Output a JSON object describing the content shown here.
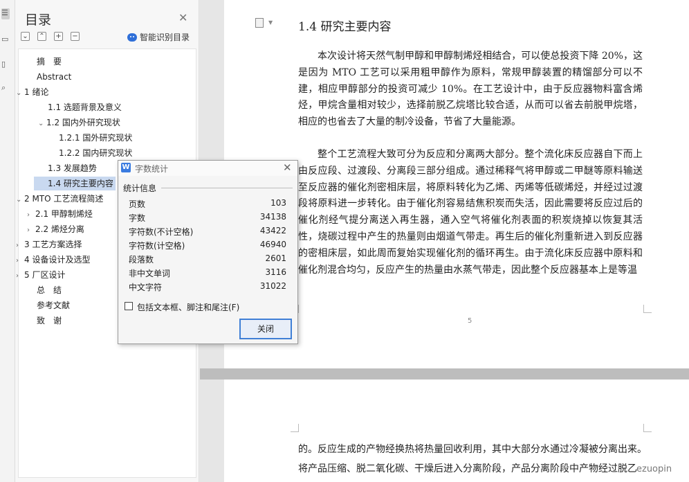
{
  "toc": {
    "title": "目录",
    "smart_label": "智能识别目录",
    "tool_icons": [
      "collapse-icon",
      "expand-icon",
      "add-icon",
      "remove-icon"
    ],
    "items": [
      {
        "label": "摘　要",
        "level": 1,
        "arrow": ""
      },
      {
        "label": "Abstract",
        "level": 1,
        "arrow": ""
      },
      {
        "label": "1 绪论",
        "level": 0,
        "arrow": "v"
      },
      {
        "label": "1.1 选题背景及意义",
        "level": 2,
        "arrow": ""
      },
      {
        "label": "1.2 国内外研究现状",
        "level": 2,
        "arrow": "v"
      },
      {
        "label": "1.2.1 国外研究现状",
        "level": 3,
        "arrow": ""
      },
      {
        "label": "1.2.2 国内研究现状",
        "level": 3,
        "arrow": ""
      },
      {
        "label": "1.3 发展趋势",
        "level": 2,
        "arrow": ""
      },
      {
        "label": "1.4 研究主要内容",
        "level": 2,
        "arrow": "",
        "selected": true
      },
      {
        "label": "2 MTO 工艺流程简述",
        "level": 0,
        "arrow": "v"
      },
      {
        "label": "2.1 甲醇制烯烃",
        "level": 1.5,
        "arrow": ">"
      },
      {
        "label": "2.2 烯烃分离",
        "level": 1.5,
        "arrow": ">"
      },
      {
        "label": "3 工艺方案选择",
        "level": 0,
        "arrow": ">"
      },
      {
        "label": "4 设备设计及选型",
        "level": 0,
        "arrow": ">"
      },
      {
        "label": "5 厂区设计",
        "level": 0,
        "arrow": ">"
      },
      {
        "label": "总　结",
        "level": 1,
        "arrow": ""
      },
      {
        "label": "参考文献",
        "level": 1,
        "arrow": ""
      },
      {
        "label": "致　谢",
        "level": 1,
        "arrow": ""
      }
    ]
  },
  "doc": {
    "heading": "1.4 研究主要内容",
    "para1": "本次设计将天然气制甲醇和甲醇制烯烃相结合，可以使总投资下降 20%，这是因为 MTO 工艺可以采用粗甲醇作为原料，常规甲醇装置的精馏部分可以不建，相应甲醇部分的投资可减少 10%。在工艺设计中，由于反应器物料富含烯烃，甲烷含量相对较少，选择前脱乙烷塔比较合适，从而可以省去前脱甲烷塔，相应的也省去了大量的制冷设备，节省了大量能源。",
    "para2": "整个工艺流程大致可分为反应和分离两大部分。整个流化床反应器自下而上由反应段、过渡段、分离段三部分组成。通过稀释气将甲醇或二甲醚等原料输送至反应器的催化剂密相床层，将原料转化为乙烯、丙烯等低碳烯烃，并经过过渡段将原料进一步转化。由于催化剂容易结焦积炭而失活，因此需要将反应过后的催化剂经气提分离送入再生器，通入空气将催化剂表面的积炭烧掉以恢复其活性，烧碳过程中产生的热量则由烟道气带走。再生后的催化剂重新进入到反应器的密相床层，如此周而复始实现催化剂的循环再生。由于流化床反应器中原料和催化剂混合均匀，反应产生的热量由水蒸气带走，因此整个反应器基本上是等温",
    "page_number": "5",
    "page2_line1": "的。反应生成的产物经换热将热量回收利用，其中大部分水通过冷凝被分离出来。",
    "page2_line2": "将产品压缩、脱二氧化碳、干燥后进入分离阶段，产品分离阶段中产物经过脱乙"
  },
  "dialog": {
    "title": "字数统计",
    "section": "统计信息",
    "stats": [
      {
        "label": "页数",
        "value": "103"
      },
      {
        "label": "字数",
        "value": "34138"
      },
      {
        "label": "字符数(不计空格)",
        "value": "43422"
      },
      {
        "label": "字符数(计空格)",
        "value": "46940"
      },
      {
        "label": "段落数",
        "value": "2601"
      },
      {
        "label": "非中文单词",
        "value": "3116"
      },
      {
        "label": "中文字符",
        "value": "31022"
      }
    ],
    "checkbox_label": "包括文本框、脚注和尾注(F)",
    "close_label": "关闭"
  },
  "watermark": "ezuopin",
  "colors": {
    "accent": "#3f7fd6",
    "selected_bg": "#c9d9f0"
  }
}
